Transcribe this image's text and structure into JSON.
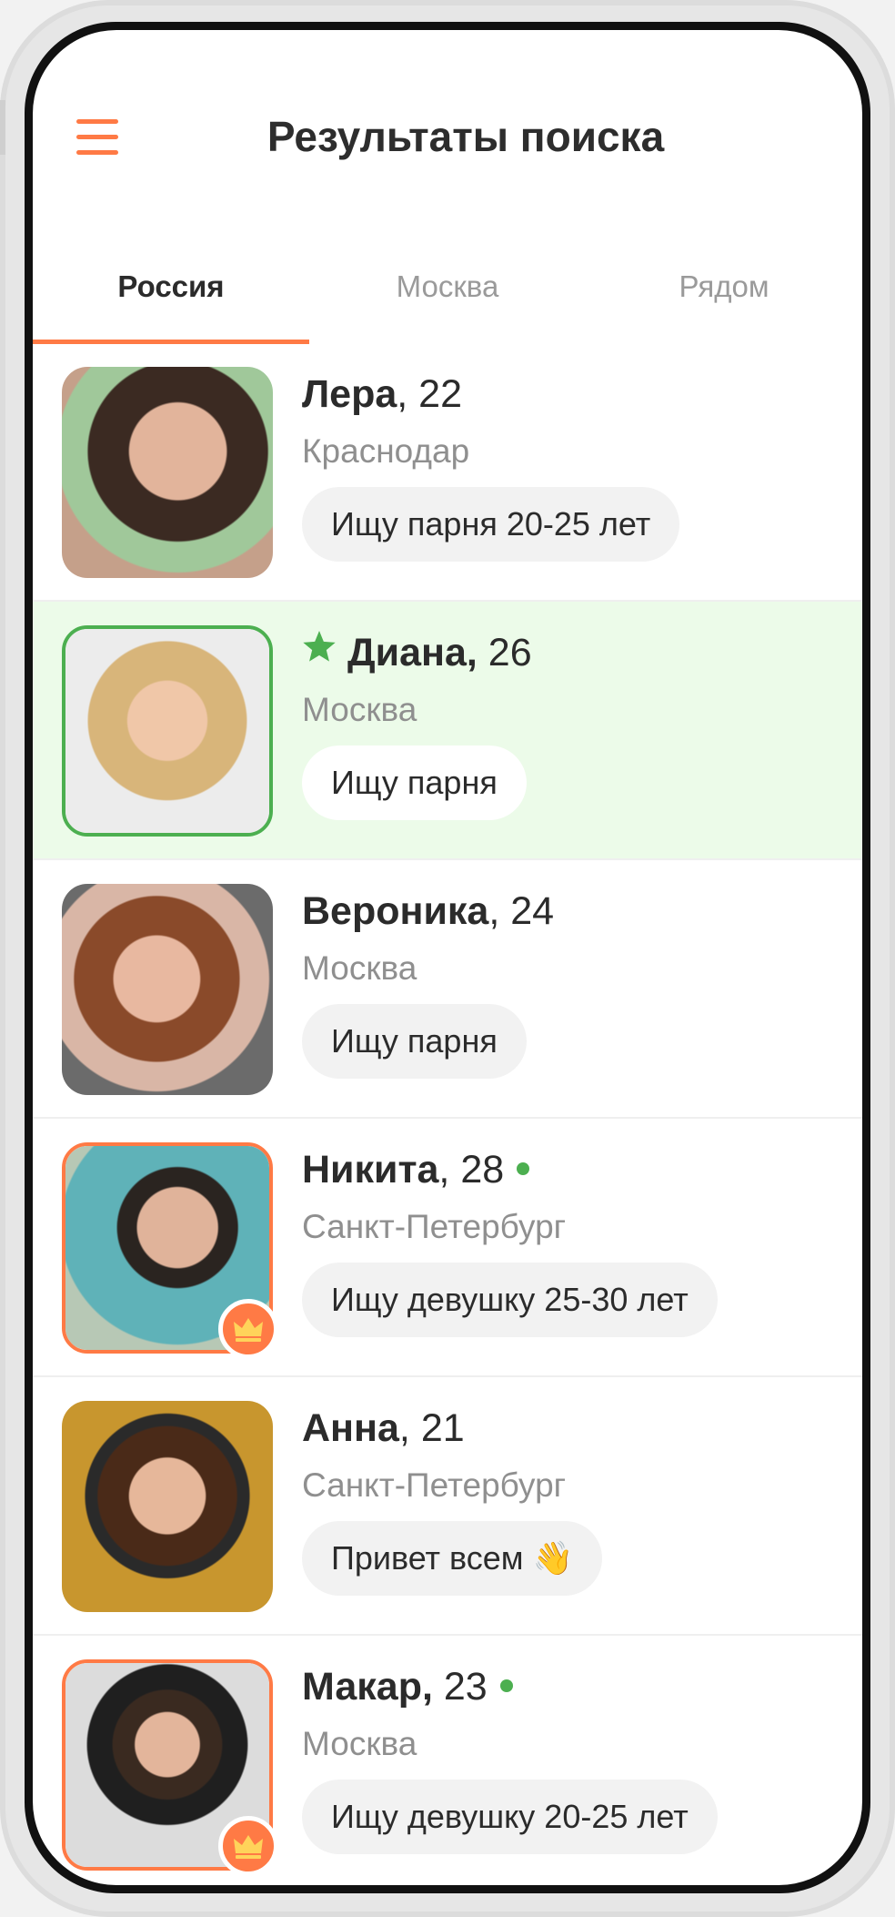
{
  "header": {
    "title": "Результаты поиска",
    "menu_icon": "hamburger-menu-icon"
  },
  "tabs": [
    {
      "label": "Россия",
      "active": true
    },
    {
      "label": "Москва",
      "active": false
    },
    {
      "label": "Рядом",
      "active": false
    }
  ],
  "colors": {
    "accent": "#ff7a45",
    "online": "#4caf50",
    "highlight_bg": "#ecfbe9"
  },
  "profiles": [
    {
      "name": "Лера",
      "age": ", 22",
      "city": "Краснодар",
      "tag": "Ищу парня 20-25 лет"
    },
    {
      "name": "Диана,",
      "age": " 26",
      "city": "Москва",
      "tag": "Ищу парня",
      "featured": true
    },
    {
      "name": "Вероника",
      "age": ", 24",
      "city": "Москва",
      "tag": "Ищу парня"
    },
    {
      "name": "Никита",
      "age": ", 28",
      "city": "Санкт-Петербург",
      "tag": "Ищу девушку 25-30 лет",
      "online": true,
      "premium": true
    },
    {
      "name": "Анна",
      "age": ", 21",
      "city": "Санкт-Петербург",
      "tag": "Привет всем 👋"
    },
    {
      "name": "Макар,",
      "age": " 23",
      "city": "Москва",
      "tag": "Ищу девушку 20-25 лет",
      "online": true,
      "premium": true
    }
  ]
}
